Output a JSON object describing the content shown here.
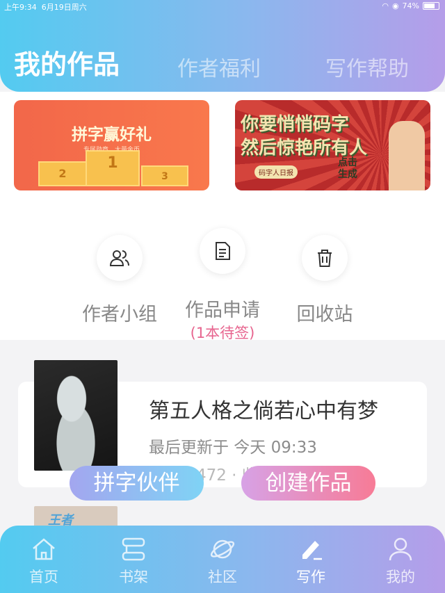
{
  "status_bar": {
    "time": "上午9:34",
    "date": "6月19日周六",
    "battery": "74%"
  },
  "header": {
    "tabs": [
      "我的作品",
      "作者福利",
      "写作帮助"
    ],
    "active_tab": 0
  },
  "banners": {
    "left": {
      "title": "拼字赢好礼",
      "subtitle": "专属勋章、大量金币",
      "podium": [
        "2",
        "1",
        "3"
      ]
    },
    "right": {
      "line1": "你要悄悄码字",
      "line2": "然后惊艳所有人",
      "stamp": "码字人日报",
      "cta_1": "点击",
      "cta_2": "生成"
    }
  },
  "shortcuts": [
    {
      "label": "作者小组",
      "icon": "group-icon"
    },
    {
      "label": "作品申请",
      "sub": "(1本待签)",
      "icon": "document-icon"
    },
    {
      "label": "回收站",
      "icon": "trash-icon"
    }
  ],
  "works": [
    {
      "title": "第五人格之倘若心中有梦",
      "updated": "最后更新于 今天 09:33",
      "stats": "字数 0472 · 收藏 0 · 评论 0"
    }
  ],
  "second_cover_text": "王者",
  "floating_buttons": {
    "partner": "拼字伙伴",
    "create": "创建作品"
  },
  "bottom_nav": [
    {
      "label": "首页",
      "icon": "home-icon"
    },
    {
      "label": "书架",
      "icon": "bookshelf-icon"
    },
    {
      "label": "社区",
      "icon": "planet-icon"
    },
    {
      "label": "写作",
      "icon": "pen-icon",
      "active": true
    },
    {
      "label": "我的",
      "icon": "profile-icon"
    }
  ]
}
